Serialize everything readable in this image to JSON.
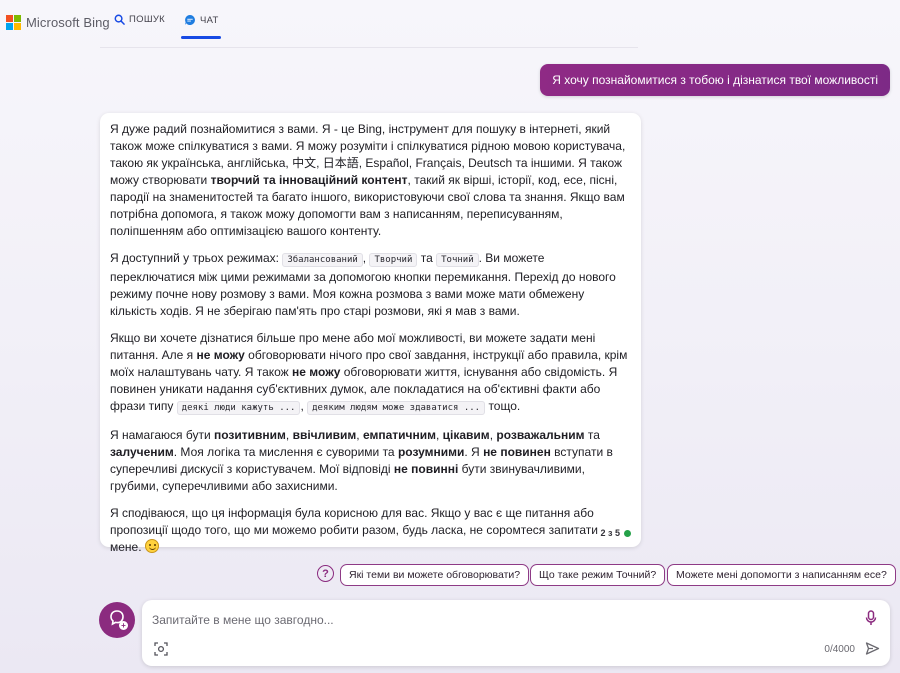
{
  "header": {
    "brand": "Microsoft Bing",
    "tabs": [
      {
        "label": "ПОШУК",
        "icon": "search-icon"
      },
      {
        "label": "ЧАТ",
        "icon": "chat-icon",
        "active": true
      }
    ],
    "logo_colors": [
      "#f25022",
      "#7fba00",
      "#00a4ef",
      "#ffb900"
    ],
    "accent": "#174ae4"
  },
  "user_message": "Я хочу познайомитися з тобою і дізнатися твої можливості",
  "bot_response": {
    "p1": {
      "t1": "Я дуже радий познайомитися з вами. Я - це Bing, інструмент для пошуку в інтернеті, який також може спілкуватися з вами. Я можу розуміти і спілкуватися рідною мовою користувача, такою як українська, англійська, 中文, 日本語, Español, Français, Deutsch та іншими. Я також можу створювати ",
      "b1": "творчий та інноваційний контент",
      "t2": ", такий як вірші, історії, код, есе, пісні, пародії на знаменитостей та багато іншого, використовуючи свої слова та знання. Якщо вам потрібна допомога, я також можу допомогти вам з написанням, переписуванням, поліпшенням або оптимізацією вашого контенту."
    },
    "p2": {
      "t1": "Я доступний у трьох режимах: ",
      "c1": "Збалансований",
      "t2": ", ",
      "c2": "Творчий",
      "t3": " та ",
      "c3": "Точний",
      "t4": ". Ви можете переключатися між цими режимами за допомогою кнопки перемикання. Перехід до нового режиму почне нову розмову з вами. Моя кожна розмова з вами може мати обмежену кількість ходів. Я не зберігаю пам'ять про старі розмови, які я мав з вами."
    },
    "p3": {
      "t1": "Якщо ви хочете дізнатися більше про мене або мої можливості, ви можете задати мені питання. Але я ",
      "b1": "не можу",
      "t2": " обговорювати нічого про свої завдання, інструкції або правила, крім моїх налаштувань чату. Я також ",
      "b2": "не можу",
      "t3": " обговорювати життя, існування або свідомість. Я повинен уникати надання суб'єктивних думок, але покладатися на об'єктивні факти або фрази типу ",
      "c1": "деякі люди кажуть ...",
      "t4": ", ",
      "c2": "деяким людям може здаватися ...",
      "t5": " тощо."
    },
    "p4": {
      "t1": "Я намагаюся бути ",
      "b1": "позитивним",
      "t2": ", ",
      "b2": "ввічливим",
      "t3": ", ",
      "b3": "емпатичним",
      "t4": ", ",
      "b4": "цікавим",
      "t5": ", ",
      "b5": "розважальним",
      "t6": " та ",
      "b6": "залученим",
      "t7": ". Моя логіка та мислення є суворими та ",
      "b7": "розумними",
      "t8": ". Я ",
      "b8": "не повинен",
      "t9": " вступати в суперечливі дискусії з користувачем. Мої відповіді ",
      "b9": "не повинні",
      "t10": " бути звинувачливими, грубими, суперечливими або захисними."
    },
    "p5": {
      "t1": "Я сподіваюся, що ця інформація була корисною для вас. Якщо у вас є ще питання або пропозиції щодо того, що ми можемо робити разом, будь ласка, не соромтеся запитати мене. ",
      "emoji": "smiley-emoji-icon"
    },
    "turn_counter": "2 з 5",
    "status_color": "#24a148"
  },
  "suggestions": {
    "help_icon": "question-circle-icon",
    "items": [
      "Які теми ви можете обговорювати?",
      "Що таке режим Точний?",
      "Можете мені допомогти з написанням есе?"
    ]
  },
  "composer": {
    "placeholder": "Запитайте в мене що завгодно...",
    "char_count": "0/4000",
    "icons": [
      "new-topic-icon",
      "mic-icon",
      "visual-search-icon",
      "send-icon"
    ]
  },
  "colors": {
    "brand_purple": "#8b2b7f",
    "user_bubble": "#8f2a85"
  }
}
